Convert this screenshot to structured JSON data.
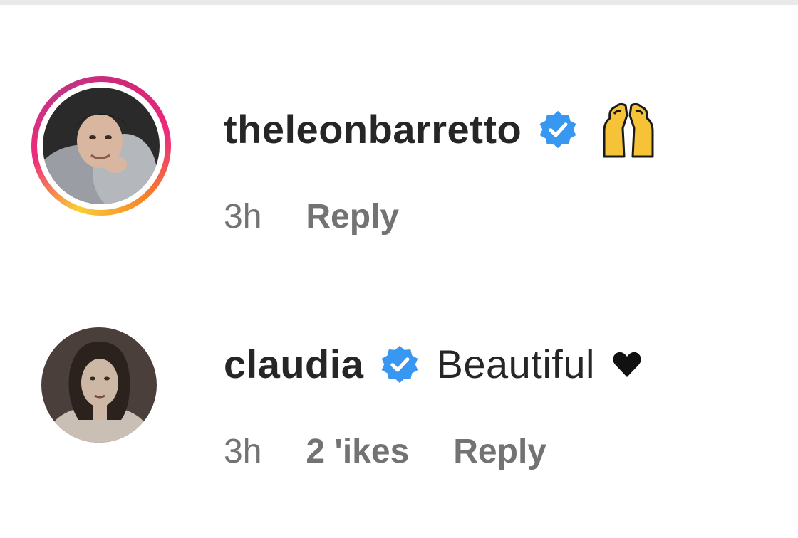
{
  "colors": {
    "text_primary": "#262626",
    "text_secondary": "#737373",
    "verified": "#3897f0",
    "story_ring": [
      "#f9ce34",
      "#ee2a7b",
      "#c13584",
      "#f58529"
    ]
  },
  "comments": [
    {
      "username": "theleonbarretto",
      "verified": true,
      "verified_icon": "verified-badge-icon",
      "text": "",
      "emoji": "raising-hands-emoji-icon",
      "timestamp": "3h",
      "likes": "",
      "reply_label": "Reply",
      "has_story_ring": true
    },
    {
      "username": "claudia",
      "verified": true,
      "verified_icon": "verified-badge-icon",
      "text": "Beautiful",
      "emoji": "black-heart-icon",
      "timestamp": "3h",
      "likes": "2 'ikes",
      "reply_label": "Reply",
      "has_story_ring": false
    }
  ]
}
